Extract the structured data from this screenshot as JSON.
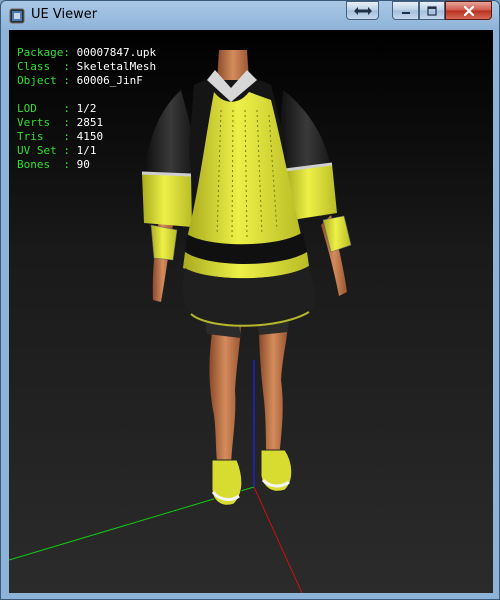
{
  "window": {
    "title": "UE Viewer",
    "icons": {
      "app": "ue-viewer-app-icon",
      "restore_size": "double-arrow-icon",
      "minimize": "minimize-icon",
      "maximize": "maximize-icon",
      "close": "close-x-icon"
    }
  },
  "info": {
    "package_label": "Package:",
    "package_value": "00007847.upk",
    "class_label": "Class  :",
    "class_value": "SkeletalMesh",
    "object_label": "Object :",
    "object_value": "60006_JinF",
    "lod_label": "LOD    :",
    "lod_value": "1/2",
    "verts_label": "Verts  :",
    "verts_value": "2851",
    "tris_label": "Tris   :",
    "tris_value": "4150",
    "uvset_label": "UV Set :",
    "uvset_value": "1/1",
    "bones_label": "Bones  :",
    "bones_value": "90"
  },
  "colors": {
    "label": "#33dd33",
    "value": "#ffffff",
    "axis_x": "#cc1111",
    "axis_y": "#11cc11",
    "axis_z": "#2222ee",
    "outfit_yellow": "#e4e83a",
    "outfit_black": "#1c1c1c",
    "skin": "#c77a4e"
  }
}
